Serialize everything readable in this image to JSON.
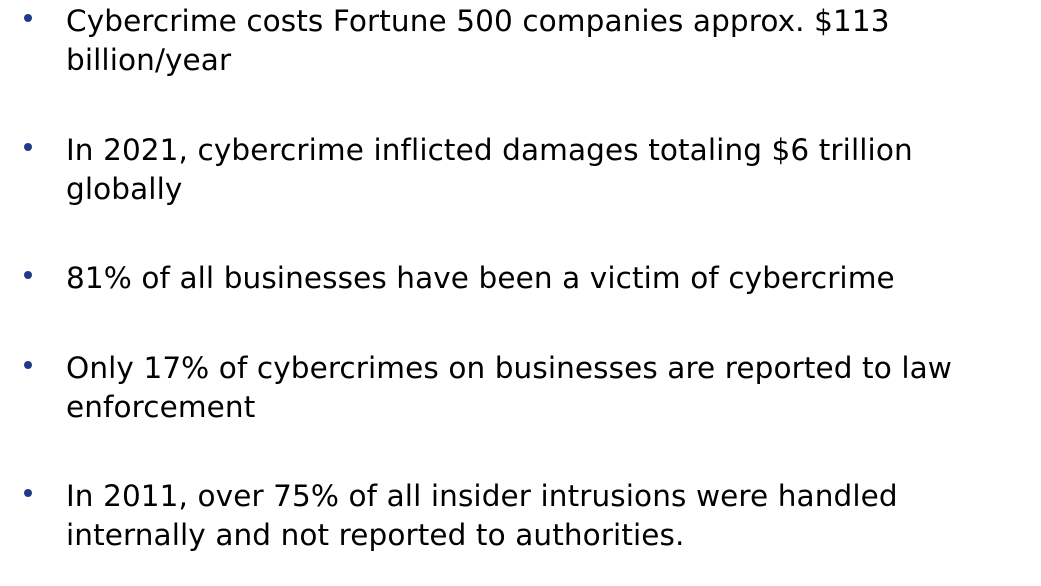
{
  "slide": {
    "bullet_color": "#1F3A8A",
    "bullets": [
      {
        "text": "Cybercrime costs Fortune 500 companies approx. $113 billion/year"
      },
      {
        "text": "In 2021, cybercrime inflicted damages totaling $6 trillion globally"
      },
      {
        "text": "81% of all businesses have been a victim of cybercrime"
      },
      {
        "text": "Only 17% of cybercrimes on businesses are reported to law enforcement"
      },
      {
        "text": "In 2011, over 75% of all insider intrusions were handled internally and not reported to authorities."
      }
    ]
  }
}
